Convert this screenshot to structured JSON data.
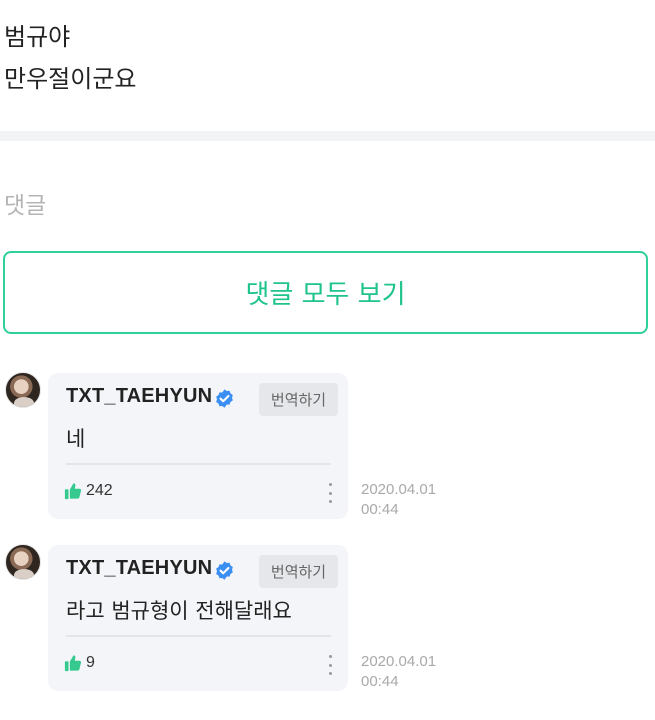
{
  "post": {
    "lines": [
      "범규야",
      "만우절이군요"
    ]
  },
  "comments_section": {
    "label": "댓글",
    "view_all_label": "댓글 모두 보기"
  },
  "colors": {
    "accent": "#2ed199",
    "verified": "#3b8ff3",
    "like": "#35c98f"
  },
  "comments": [
    {
      "author": "TXT_TAEHYUN",
      "verified_icon": "verified-badge-icon",
      "translate_label": "번역하기",
      "text": "네",
      "likes": "242",
      "date": "2020.04.01",
      "time": "00:44"
    },
    {
      "author": "TXT_TAEHYUN",
      "verified_icon": "verified-badge-icon",
      "translate_label": "번역하기",
      "text": "라고 범규형이 전해달래요",
      "likes": "9",
      "date": "2020.04.01",
      "time": "00:44"
    }
  ]
}
